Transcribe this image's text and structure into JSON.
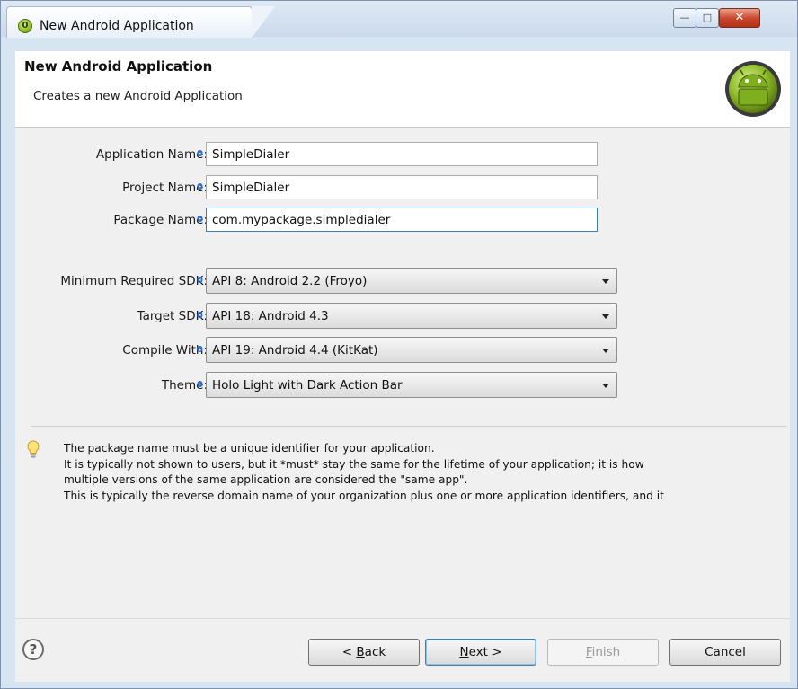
{
  "window": {
    "title": "New Android Application",
    "minimize_glyph": "—",
    "maximize_glyph": "□",
    "close_glyph": "✕"
  },
  "header": {
    "title": "New Android Application",
    "subtitle": "Creates a new Android Application"
  },
  "form": {
    "info_glyph": "0",
    "application_name": {
      "label": "Application Name:",
      "value": "SimpleDialer"
    },
    "project_name": {
      "label": "Project Name:",
      "value": "SimpleDialer"
    },
    "package_name": {
      "label": "Package Name:",
      "value": "com.mypackage.simpledialer"
    },
    "min_sdk": {
      "label": "Minimum Required SDK:",
      "value": "API 8: Android 2.2 (Froyo)"
    },
    "target_sdk": {
      "label": "Target SDK:",
      "value": "API 18: Android 4.3"
    },
    "compile_with": {
      "label": "Compile With:",
      "value": "API 19: Android 4.4 (KitKat)"
    },
    "theme": {
      "label": "Theme:",
      "value": "Holo Light with Dark Action Bar"
    }
  },
  "hint": {
    "lines": [
      "The package name must be a unique identifier for your application.",
      "It is typically not shown to users, but it *must* stay the same for the lifetime of your application; it is how",
      "multiple versions of the same application are considered the \"same app\".",
      "This is typically the reverse domain name of your organization plus one or more application identifiers, and it"
    ]
  },
  "footer": {
    "help_glyph": "?",
    "back": {
      "prefix": "< ",
      "mnemonic": "B",
      "rest": "ack"
    },
    "next": {
      "mnemonic": "N",
      "rest": "ext >"
    },
    "finish": {
      "mnemonic": "F",
      "rest": "inish"
    },
    "cancel": "Cancel"
  },
  "icons": {
    "app": "android-adt-icon",
    "logo": "android-logo-icon",
    "hint": "lightbulb-icon",
    "help": "help-icon"
  },
  "colors": {
    "info_marker": "#2a6fd6",
    "android_green": "#8ebb2a",
    "default_button_border": "#3c7fb1"
  }
}
